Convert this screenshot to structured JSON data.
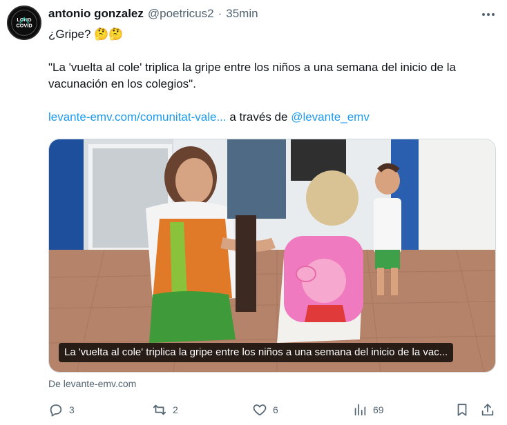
{
  "tweet": {
    "author_name": "antonio gonzalez",
    "handle": "@poetricus2",
    "separator": "·",
    "time": "35min",
    "avatar_text": [
      "LONG",
      "COVID"
    ],
    "line1": "¿Gripe? 🤔🤔",
    "quote": "\"La 'vuelta al cole' triplica la gripe entre los niños a una semana del inicio de la vacunación en los colegios\".",
    "link_text": "levante-emv.com/comunitat-vale...",
    "via_text": " a través de ",
    "mention": "@levante_emv"
  },
  "media": {
    "caption": "La 'vuelta al cole' triplica la gripe entre los niños a una semana del inicio de la vac...",
    "source": "De levante-emv.com"
  },
  "actions": {
    "replies": "3",
    "retweets": "2",
    "likes": "6",
    "views": "69"
  },
  "icons": {
    "more": "more-icon",
    "reply": "reply-icon",
    "retweet": "retweet-icon",
    "like": "heart-icon",
    "views": "views-icon",
    "bookmark": "bookmark-icon",
    "share": "share-icon"
  },
  "colors": {
    "link": "#1d9bf0",
    "secondary_text": "#536471",
    "primary_text": "#0f1419"
  }
}
